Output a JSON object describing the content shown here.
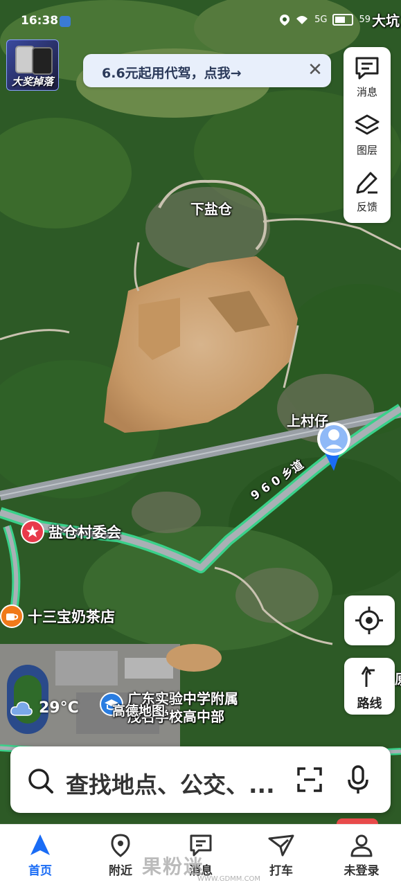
{
  "status_bar": {
    "time": "16:38",
    "net": "5G",
    "battery": "59",
    "corner_place": "大坑"
  },
  "promo": {
    "thumb_label": "大奖掉落",
    "banner_text": "6.6元起用代驾，点我→",
    "close_glyph": "✕"
  },
  "right_toolbar": {
    "items": [
      {
        "icon": "message-icon",
        "label": "消息"
      },
      {
        "icon": "layers-icon",
        "label": "图层"
      },
      {
        "icon": "feedback-pen-icon",
        "label": "反馈"
      }
    ]
  },
  "map": {
    "place_labels": {
      "xia_yan_cang": "下盐仓",
      "shang_cun_zai": "上村仔"
    },
    "road_label": "9 6 0 乡道",
    "pois": [
      {
        "name": "盐仓村委会",
        "icon": "star-pin-icon",
        "color": "#e8394a"
      },
      {
        "name": "十三宝奶茶店",
        "icon": "coffee-cup-icon",
        "color": "#f07a1a"
      },
      {
        "name_line1": "广东实验中学附属",
        "name_line2": "茂名学校高中部",
        "icon": "school-icon",
        "color": "#2a7de1"
      }
    ],
    "brand_logo_text": "高德地图",
    "edge_label": "原",
    "colors": {
      "route": "#3ad18a",
      "road": "#9aa0a6"
    }
  },
  "controls": {
    "locate_icon": "crosshair-icon",
    "route_label": "路线"
  },
  "weather": {
    "icon": "cloud-icon",
    "temp": "29°C"
  },
  "search": {
    "placeholder": "查找地点、公交、..."
  },
  "tabs": [
    {
      "label": "首页",
      "icon": "navigation-arrow-icon",
      "active": true
    },
    {
      "label": "附近",
      "icon": "location-pin-icon",
      "active": false
    },
    {
      "label": "消息",
      "icon": "chat-bubble-icon",
      "active": false
    },
    {
      "label": "打车",
      "icon": "taxi-flag-icon",
      "active": false
    },
    {
      "label": "未登录",
      "icon": "user-icon",
      "active": false
    }
  ],
  "watermark": {
    "text": "果粉迷",
    "url": "WWW.GDMM.COM"
  }
}
